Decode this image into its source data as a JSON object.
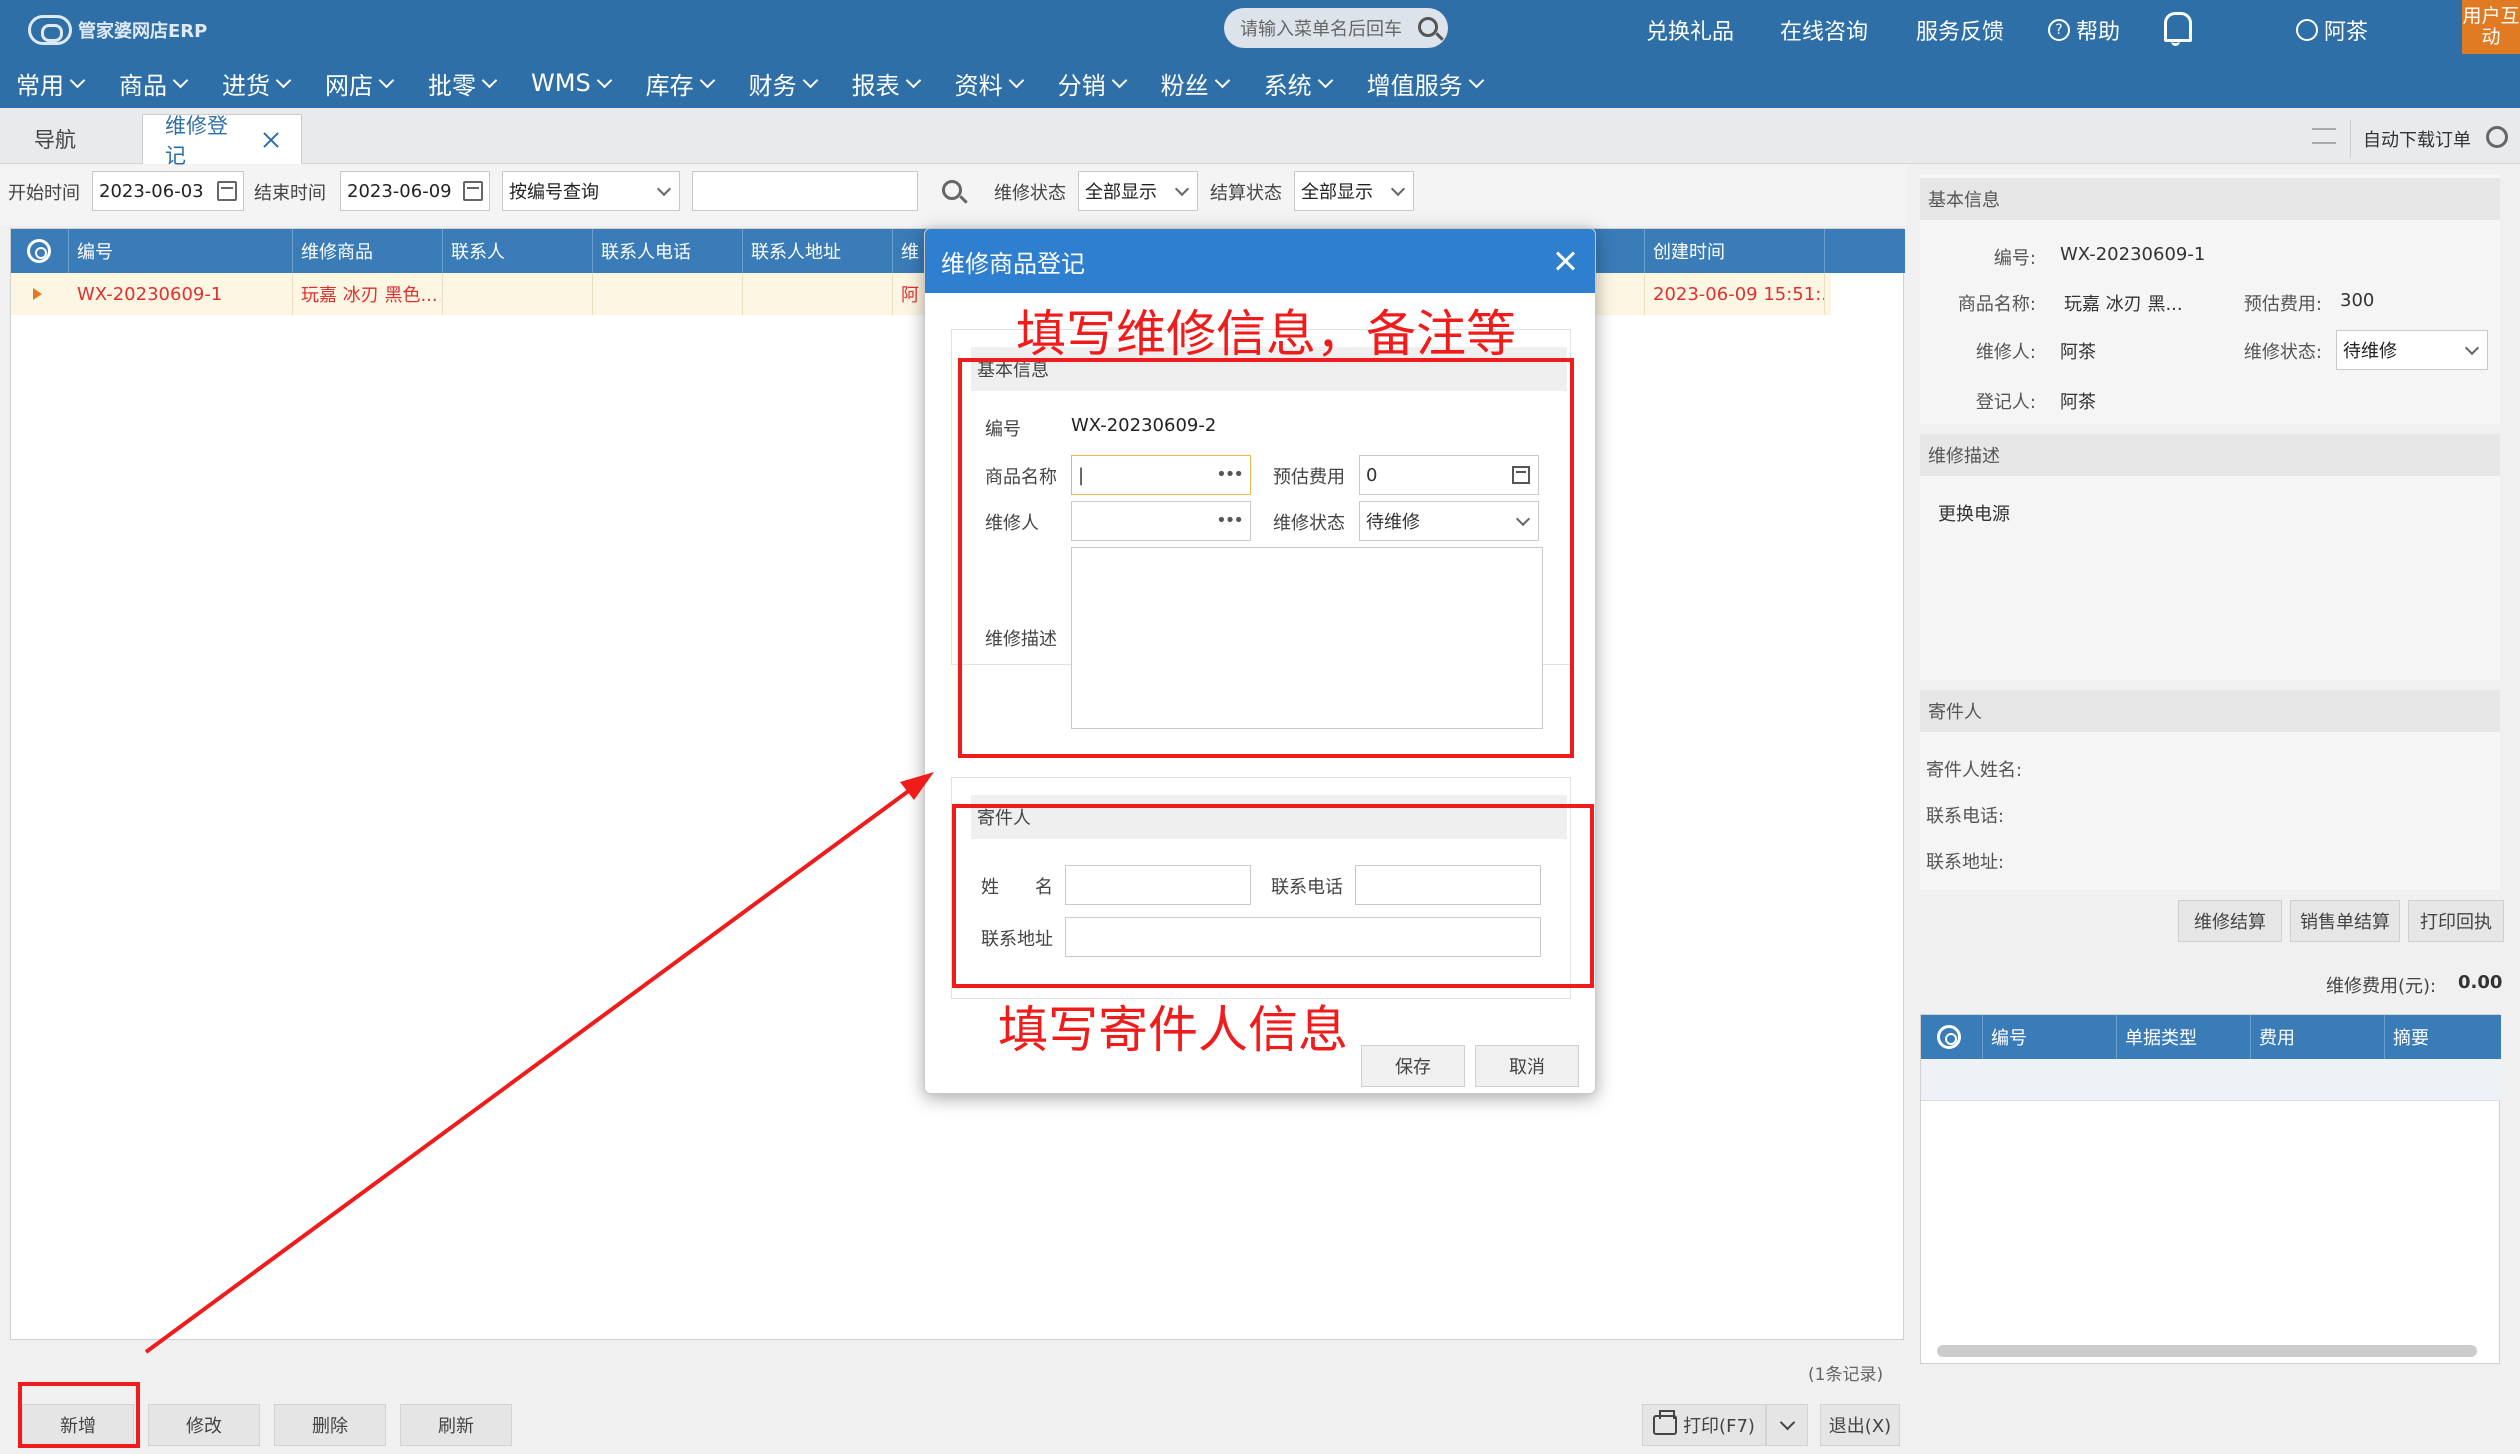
{
  "app": {
    "logo_text": "管家婆网店ERP",
    "search_placeholder": "请输入菜单名后回车"
  },
  "top_links": {
    "gifts": "兑换礼品",
    "consult": "在线咨询",
    "feedback": "服务反馈",
    "help": "帮助",
    "user": "阿茶",
    "user_interact": "用户互动"
  },
  "menu": [
    "常用",
    "商品",
    "进货",
    "网店",
    "批零",
    "WMS",
    "库存",
    "财务",
    "报表",
    "资料",
    "分销",
    "粉丝",
    "系统",
    "增值服务"
  ],
  "tabs": {
    "nav": "导航",
    "repair": "维修登记",
    "auto_download": "自动下载订单"
  },
  "filter": {
    "start_label": "开始时间",
    "start_value": "2023-06-03",
    "end_label": "结束时间",
    "end_value": "2023-06-09",
    "query_mode": "按编号查询",
    "query_text": "",
    "repair_status_label": "维修状态",
    "repair_status_value": "全部显示",
    "settle_status_label": "结算状态",
    "settle_status_value": "全部显示"
  },
  "grid": {
    "columns": [
      "编号",
      "维修商品",
      "联系人",
      "联系人电话",
      "联系人地址",
      "维",
      "创建时间"
    ],
    "rows": [
      {
        "id": "WX-20230609-1",
        "product": "玩嘉 冰刃 黑色...",
        "contact": "",
        "phone": "",
        "address": "",
        "repairer": "阿",
        "created": "2023-06-09 15:51:..."
      }
    ],
    "records": "(1条记录)"
  },
  "bottom_buttons": {
    "add": "新增",
    "edit": "修改",
    "delete": "删除",
    "refresh": "刷新",
    "print": "打印(F7)",
    "exit": "退出(X)"
  },
  "right_panel": {
    "basic_title": "基本信息",
    "id_label": "编号:",
    "id_value": "WX-20230609-1",
    "product_label": "商品名称:",
    "product_value": "玩嘉 冰刃 黑...",
    "est_cost_label": "预估费用:",
    "est_cost_value": "300",
    "repairer_label": "维修人:",
    "repairer_value": "阿茶",
    "status_label": "维修状态:",
    "status_value": "待维修",
    "register_label": "登记人:",
    "register_value": "阿茶",
    "desc_title": "维修描述",
    "desc_value": "更换电源",
    "sender_title": "寄件人",
    "sender_name_label": "寄件人姓名:",
    "sender_phone_label": "联系电话:",
    "sender_addr_label": "联系地址:",
    "btn_settle": "维修结算",
    "btn_sales_settle": "销售单结算",
    "btn_print_receipt": "打印回执",
    "fee_label": "维修费用(元):",
    "fee_value": "0.00",
    "grid_columns": [
      "编号",
      "单据类型",
      "费用",
      "摘要"
    ]
  },
  "modal": {
    "title": "维修商品登记",
    "basic_title": "基本信息",
    "id_label": "编号",
    "id_value": "WX-20230609-2",
    "product_label": "商品名称",
    "product_value": "|",
    "est_cost_label": "预估费用",
    "est_cost_value": "0",
    "repairer_label": "维修人",
    "repairer_value": "",
    "status_label": "维修状态",
    "status_value": "待维修",
    "desc_label": "维修描述",
    "desc_value": "",
    "sender_title": "寄件人",
    "name_label": "姓　　名",
    "name_value": "",
    "phone_label": "联系电话",
    "phone_value": "",
    "addr_label": "联系地址",
    "addr_value": "",
    "save": "保存",
    "cancel": "取消"
  },
  "annotations": {
    "fill_repair": "填写维修信息，备注等",
    "fill_sender": "填写寄件人信息"
  },
  "colors": {
    "header": "#2e6fa7",
    "grid_header": "#3a7cb8",
    "modal_title": "#2e7fcf",
    "annotation": "#f01c1c",
    "row_text": "#e03030"
  }
}
